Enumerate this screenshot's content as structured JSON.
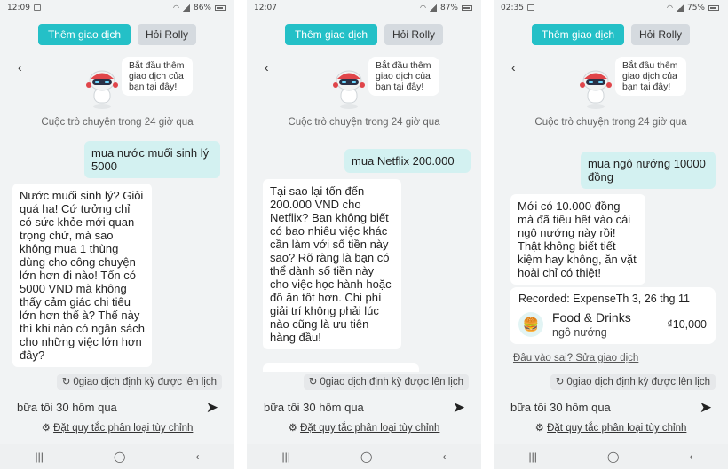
{
  "ui": {
    "add_transaction": "Thêm giao dịch",
    "ask_rolly": "Hỏi Rolly",
    "back_glyph": "‹",
    "bot_intro": "Bắt đầu thêm giao dịch của bạn tại đây!",
    "caption": "Cuộc trò chuyện trong 24 giờ qua",
    "scheduled": "0giao dịch định kỳ được lên lịch",
    "input_value": "bữa tối 30 hôm qua",
    "rules_link": "Đặt quy tắc phân loại tùy chỉnh",
    "send_icon": "send-icon",
    "nav": [
      "|||",
      "◯",
      "‹"
    ]
  },
  "screens": [
    {
      "status": {
        "time": "12:09",
        "battery": "86%"
      },
      "user_msg": "mua nước muối sinh lý 5000",
      "bot_msg": "Nước muối sinh lý? Giỏi quá ha! Cứ tưởng chỉ có sức khỏe mới quan trọng chứ, mà sao không mua 1 thùng dùng cho công chuyện lớn hơn đi nào! Tốn có 5000 VND mà không thấy cảm giác chi tiêu lớn hơn thế à? Thế này thì khi nào có ngân sách cho những việc lớn hơn đây?"
    },
    {
      "status": {
        "time": "12:07",
        "battery": "87%"
      },
      "user_msg": "mua Netflix 200.000",
      "bot_msg": "Tại sao lại tốn đến 200.000 VND cho Netflix? Bạn không biết có bao nhiêu việc khác cần làm với số tiền này sao? Rõ ràng là bạn có thể dành số tiền này cho việc học hành hoặc đồ ăn tốt hơn. Chi phí giải trí không phải lúc nào cũng là ưu tiên hàng đầu!"
    },
    {
      "status": {
        "time": "02:35",
        "battery": "75%"
      },
      "user_msg": "mua ngô nướng 10000 đồng",
      "bot_msg": "Mới có 10.000 đồng mà đã tiêu hết vào cái ngô nướng này rồi! Thật không biết tiết kiệm hay không, ăn vặt hoài chỉ có thiệt!",
      "card": {
        "recorded": "Recorded: ExpenseTh 3, 26 thg 11",
        "category": "Food & Drinks",
        "note": "ngô nướng",
        "amount": "₫10,000",
        "icon": "burger-icon"
      },
      "wrong_link": "Đâu vào sai? Sửa giao dịch"
    }
  ],
  "colors": {
    "accent": "#24c0c7",
    "user_bubble": "#d3f1f1",
    "background": "#f1f3f4"
  }
}
